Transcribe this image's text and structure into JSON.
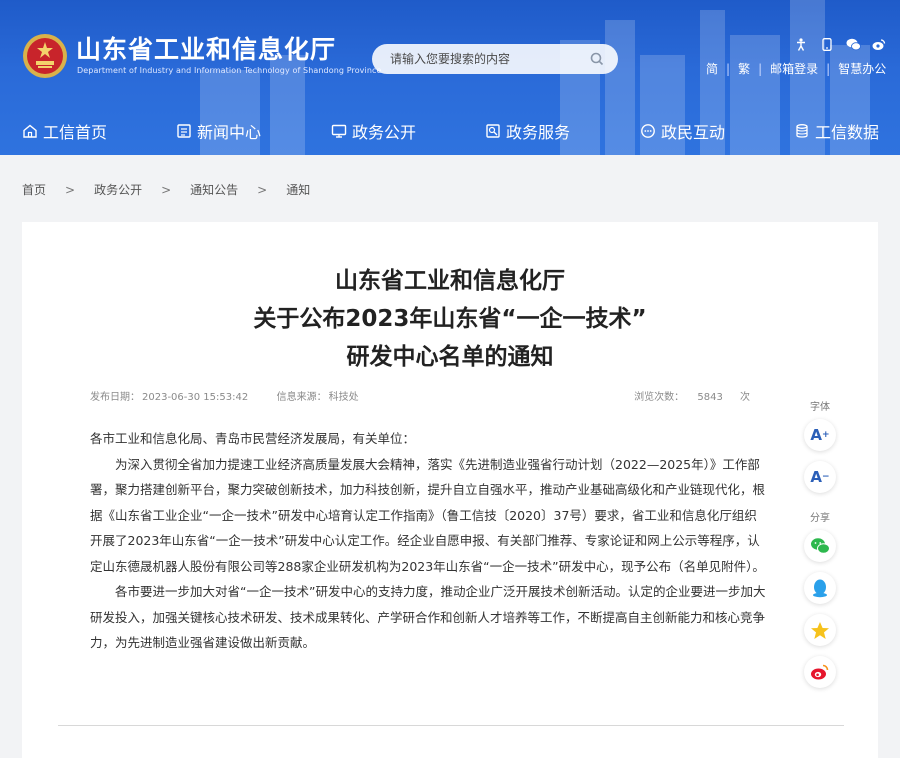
{
  "header": {
    "title": "山东省工业和信息化厅",
    "subtitle": "Department of Industry and Information Technology of Shandong Province",
    "search_placeholder": "请输入您要搜索的内容",
    "links": [
      "简",
      "繁",
      "邮箱登录",
      "智慧办公"
    ],
    "tool_icons": [
      "accessibility-icon",
      "mobile-icon",
      "wechat-icon",
      "weibo-icon"
    ]
  },
  "nav": [
    {
      "label": "工信首页",
      "icon": "home-icon"
    },
    {
      "label": "新闻中心",
      "icon": "news-icon"
    },
    {
      "label": "政务公开",
      "icon": "monitor-icon"
    },
    {
      "label": "政务服务",
      "icon": "service-icon"
    },
    {
      "label": "政民互动",
      "icon": "chat-icon"
    },
    {
      "label": "工信数据",
      "icon": "database-icon"
    }
  ],
  "breadcrumb": {
    "items": [
      "首页",
      "政务公开",
      "通知公告",
      "通知"
    ],
    "separator": ">"
  },
  "article": {
    "title_lines": [
      "山东省工业和信息化厅",
      "关于公布2023年山东省“一企一技术”",
      "研发中心名单的通知"
    ],
    "publish_label": "发布日期：",
    "publish_date": "2023-06-30 15:53:42",
    "source_label": "信息来源：",
    "source": "科技处",
    "views_label": "浏览次数：",
    "views": "5843",
    "views_unit": "次",
    "paragraphs": [
      "各市工业和信息化局、青岛市民营经济发展局，有关单位：",
      "为深入贯彻全省加力提速工业经济高质量发展大会精神，落实《先进制造业强省行动计划（2022—2025年）》工作部署，聚力搭建创新平台，聚力突破创新技术，加力科技创新，提升自立自强水平，推动产业基础高级化和产业链现代化，根据《山东省工业企业“一企一技术”研发中心培育认定工作指南》（鲁工信技〔2020〕37号）要求，省工业和信息化厅组织开展了2023年山东省“一企一技术”研发中心认定工作。经企业自愿申报、有关部门推荐、专家论证和网上公示等程序，认定山东德晟机器人股份有限公司等288家企业研发机构为2023年山东省“一企一技术”研发中心，现予公布（名单见附件）。",
      "各市要进一步加大对省“一企一技术”研发中心的支持力度，推动企业广泛开展技术创新活动。认定的企业要进一步加大研发投入，加强关键核心技术研发、技术成果转化、产学研合作和创新人才培养等工作，不断提高自主创新能力和核心竞争力，为先进制造业强省建设做出新贡献。"
    ]
  },
  "side_tools": {
    "font_label": "字体",
    "font_increase": "A",
    "font_increase_sup": "+",
    "font_decrease": "A",
    "font_decrease_sup": "−",
    "share_label": "分享",
    "share_icons": [
      "wechat-share-icon",
      "qq-share-icon",
      "qzone-share-icon",
      "weibo-share-icon"
    ]
  },
  "colors": {
    "header_blue": "#2a6ad8",
    "font_btn": "#2b5fb8"
  }
}
